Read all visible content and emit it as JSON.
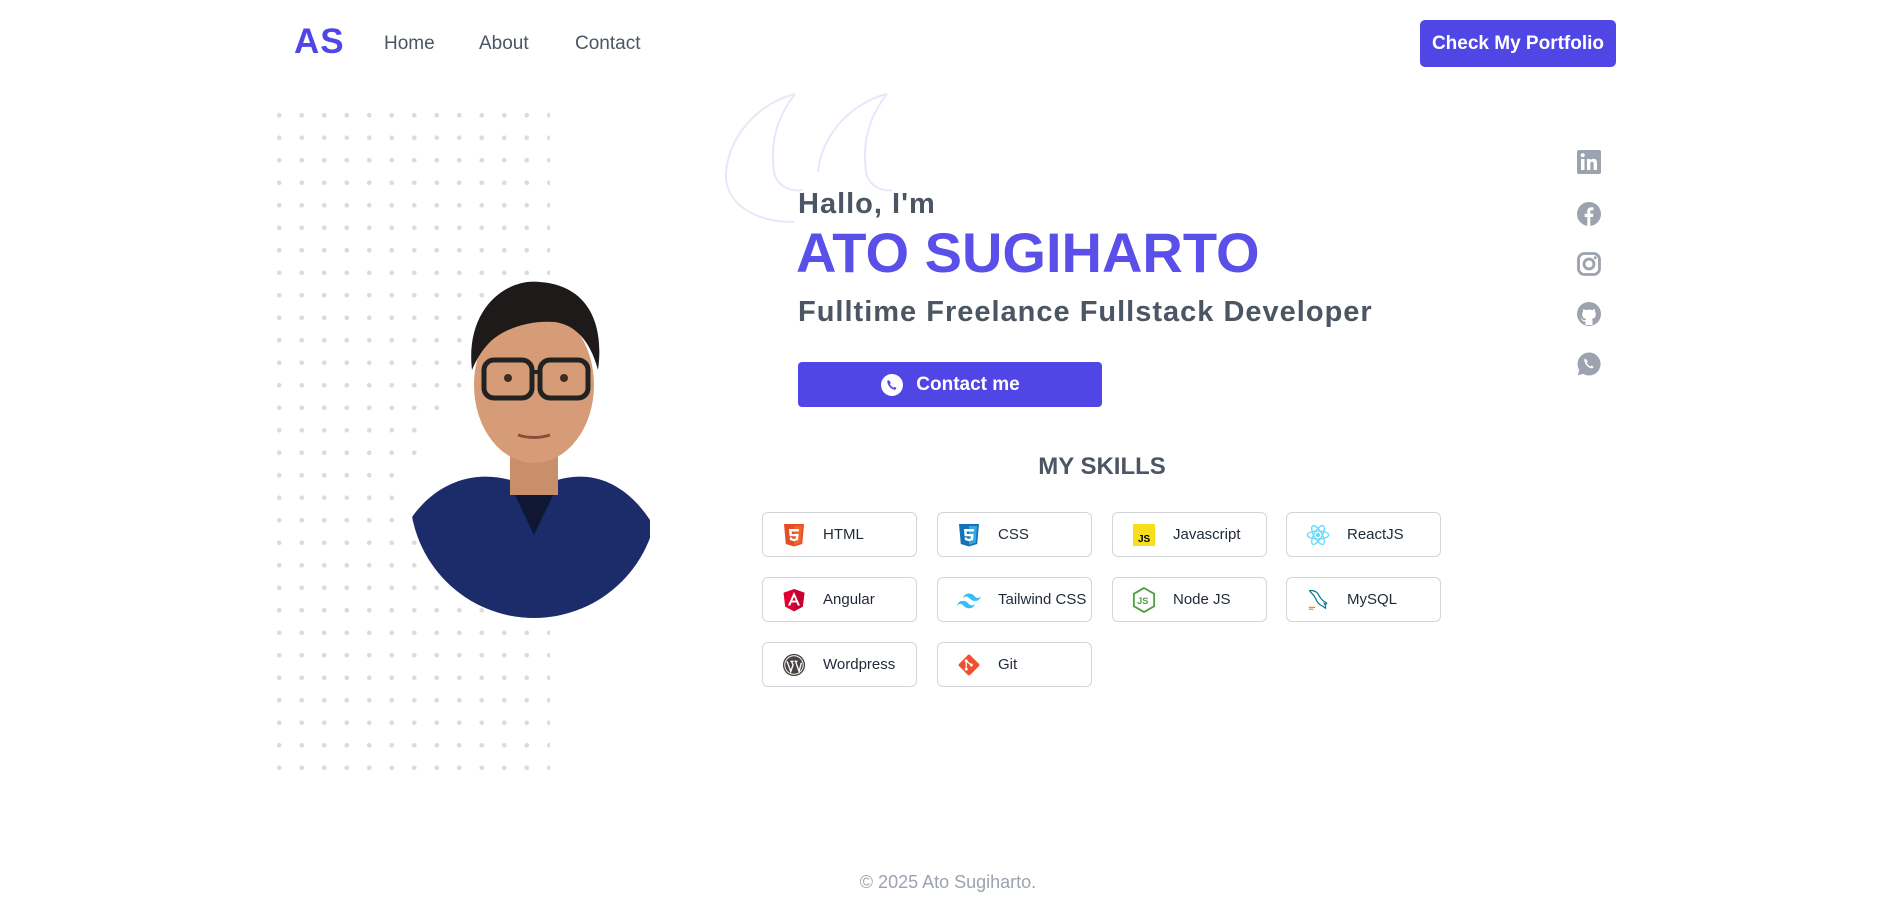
{
  "nav": {
    "logo": "AS",
    "links": [
      "Home",
      "About",
      "Contact"
    ],
    "cta_label": "Check My Portfolio"
  },
  "hero": {
    "greeting": "Hallo, I'm",
    "name": "ATO SUGIHARTO",
    "role": "Fulltime Freelance Fullstack Developer",
    "contact_label": "Contact me",
    "contact_icon": "whatsapp-icon"
  },
  "social": [
    {
      "icon": "linkedin-icon"
    },
    {
      "icon": "facebook-icon"
    },
    {
      "icon": "instagram-icon"
    },
    {
      "icon": "github-icon"
    },
    {
      "icon": "whatsapp-icon"
    }
  ],
  "skills": {
    "title": "MY SKILLS",
    "items": [
      {
        "label": "HTML",
        "icon": "html5-icon"
      },
      {
        "label": "CSS",
        "icon": "css3-icon"
      },
      {
        "label": "Javascript",
        "icon": "javascript-icon"
      },
      {
        "label": "ReactJS",
        "icon": "react-icon"
      },
      {
        "label": "Angular",
        "icon": "angular-icon"
      },
      {
        "label": "Tailwind CSS",
        "icon": "tailwind-icon"
      },
      {
        "label": "Node JS",
        "icon": "nodejs-icon"
      },
      {
        "label": "MySQL",
        "icon": "mysql-icon"
      },
      {
        "label": "Wordpress",
        "icon": "wordpress-icon"
      },
      {
        "label": "Git",
        "icon": "git-icon"
      }
    ]
  },
  "footer": {
    "text": "© 2025 Ato Sugiharto."
  },
  "colors": {
    "accent": "#4f46e5",
    "name": "#5b4fe9",
    "text": "#4b5563",
    "social_icons": "#9ca3af",
    "footer": "#9ca3af"
  }
}
